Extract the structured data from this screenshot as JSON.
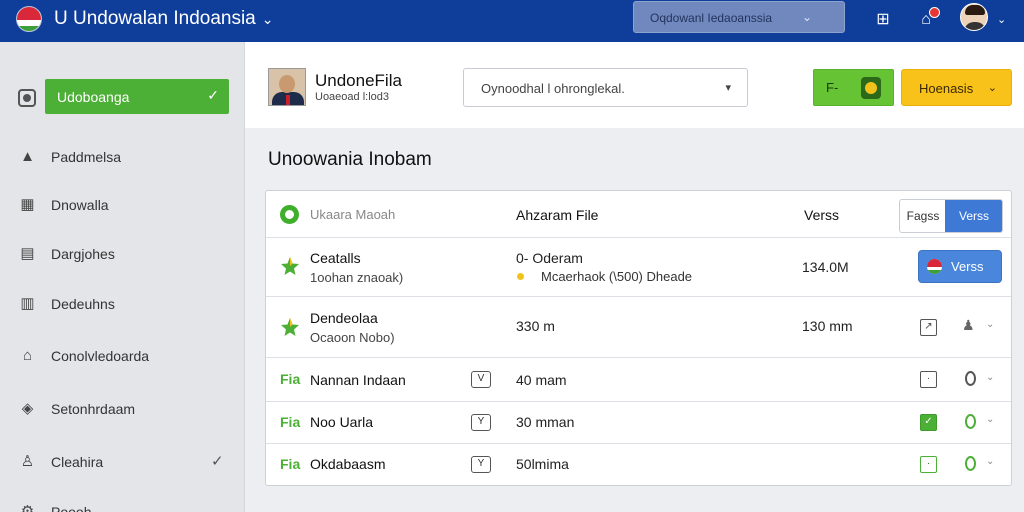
{
  "topbar": {
    "title": "U Undowalan Indoansia",
    "search_text": "Oqdowanl Iedaoanssia",
    "colors": {
      "bar": "#0f3d9a",
      "accent_green": "#4caf36",
      "accent_yellow": "#f8c21a",
      "accent_blue": "#3f79d6"
    }
  },
  "sidebar": {
    "active_label": "Udoboanga",
    "items": [
      {
        "label": "Paddmelsa",
        "icon": "home-icon"
      },
      {
        "label": "Dnowalla",
        "icon": "grid-icon"
      },
      {
        "label": "Dargjohes",
        "icon": "folder-icon"
      },
      {
        "label": "Dedeuhns",
        "icon": "document-icon"
      },
      {
        "label": "Conolvledoarda",
        "icon": "building-icon"
      },
      {
        "label": "Setonhrdaam",
        "icon": "shield-icon"
      },
      {
        "label": "Cleahira",
        "icon": "person-icon"
      },
      {
        "label": "Poooh",
        "icon": "settings-icon"
      }
    ]
  },
  "header": {
    "profile_name": "UndoneFila",
    "profile_sub": "Uoaeoad l:lod3",
    "select_text": "Oynoodhal l ohronglekal.",
    "green_button": "F-",
    "yellow_button": "Hoenasis"
  },
  "section_title": "Unoowania Inobam",
  "table": {
    "headers": {
      "name": "Ukaara Maoah",
      "file": "Ahzaram File",
      "version": "Verss"
    },
    "segment": {
      "left": "Fagss",
      "right": "Verss"
    },
    "rows": [
      {
        "title": "Ceatalls",
        "sub": "1oohan znaoak)",
        "file": "0- Oderam",
        "file_sub": "Mcaerhaok (\\500) Dheade",
        "size": "134.0M",
        "button": "Verss"
      },
      {
        "title": "Dendeolaa",
        "sub": "Ocaoon Nobo)",
        "file": "330 m",
        "size": "130 mm"
      },
      {
        "tag": "Fia",
        "title": "Nannan Indaan",
        "badge": "V",
        "file": "40 mam"
      },
      {
        "tag": "Fia",
        "title": "Noo Uarla",
        "badge": "Y",
        "file": "30 mman"
      },
      {
        "tag": "Fia",
        "title": "Okdabaasm",
        "badge": "Y",
        "file": "50lmima"
      }
    ]
  }
}
